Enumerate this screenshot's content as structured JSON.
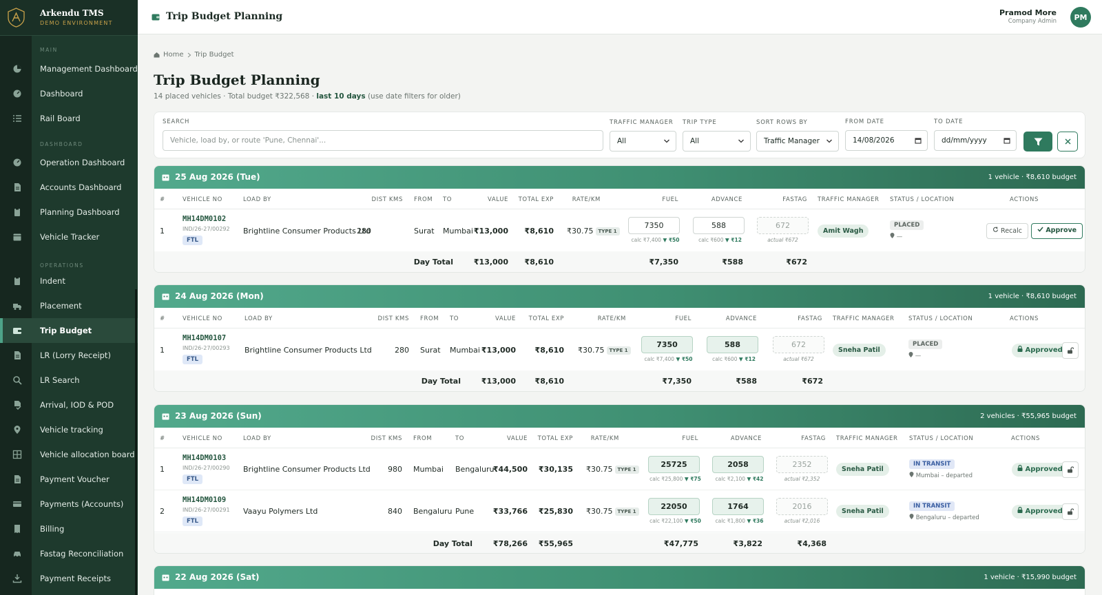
{
  "app": {
    "name": "Arkendu TMS",
    "env": "DEMO ENVIRONMENT"
  },
  "sidebar": {
    "sections": {
      "main": "MAIN",
      "dashboard": "DASHBOARD",
      "operations": "OPERATIONS"
    },
    "items": [
      {
        "label": "Management Dashboard",
        "icon": "pie-chart-icon"
      },
      {
        "label": "Dashboard",
        "icon": "gauge-icon"
      },
      {
        "label": "Rail Board",
        "icon": "list-icon"
      },
      {
        "label": "Operation Dashboard",
        "icon": "gauge-icon"
      },
      {
        "label": "Accounts Dashboard",
        "icon": "file-icon"
      },
      {
        "label": "Planning Dashboard",
        "icon": "clipboard-icon"
      },
      {
        "label": "Vehicle Tracker",
        "icon": "calendar-icon"
      },
      {
        "label": "Indent",
        "icon": "clipboard-icon"
      },
      {
        "label": "Placement",
        "icon": "truck-icon"
      },
      {
        "label": "Trip Budget",
        "icon": "wallet-icon"
      },
      {
        "label": "LR (Lorry Receipt)",
        "icon": "file-icon"
      },
      {
        "label": "LR Search",
        "icon": "search-icon"
      },
      {
        "label": "Arrival, IOD & POD",
        "icon": "file-check-icon"
      },
      {
        "label": "Vehicle tracking",
        "icon": "map-pin-icon"
      },
      {
        "label": "Vehicle allocation board",
        "icon": "grid-icon"
      },
      {
        "label": "Payment Voucher",
        "icon": "file-icon"
      },
      {
        "label": "Payments (Accounts)",
        "icon": "card-icon"
      },
      {
        "label": "Billing",
        "icon": "receipt-icon"
      },
      {
        "label": "Fastag Reconciliation",
        "icon": "car-icon"
      },
      {
        "label": "Payment Receipts",
        "icon": "download-icon"
      }
    ]
  },
  "header": {
    "title": "Trip Budget Planning",
    "user_name": "Pramod More",
    "user_role": "Company Admin",
    "avatar": "PM"
  },
  "breadcrumb": {
    "home": "Home",
    "current": "Trip Budget"
  },
  "page": {
    "title": "Trip Budget Planning",
    "subtitle_a": "14 placed vehicles · Total budget ₹322,568 · ",
    "subtitle_b": "last 10 days",
    "subtitle_c": " (use date filters for older)"
  },
  "filters": {
    "search_label": "SEARCH",
    "search_placeholder": "Vehicle, load by, or route 'Pune, Chennai'...",
    "tm_label": "TRAFFIC MANAGER",
    "tm_value": "All",
    "trip_label": "TRIP TYPE",
    "trip_value": "All",
    "sort_label": "SORT ROWS BY",
    "sort_value": "Traffic Manager",
    "from_label": "FROM DATE",
    "from_value": "14/08/2026",
    "to_label": "TO DATE",
    "to_value": "dd/mm/yyyy"
  },
  "columns": {
    "num": "#",
    "vehicle": "VEHICLE NO",
    "load": "LOAD BY",
    "dist": "DIST KMS",
    "from": "FROM",
    "to": "TO",
    "value": "VALUE",
    "total_exp": "TOTAL EXP",
    "rate": "RATE/KM",
    "fuel": "FUEL",
    "advance": "ADVANCE",
    "fastag": "FASTAG",
    "tm": "TRAFFIC MANAGER",
    "status": "STATUS / LOCATION",
    "actions": "ACTIONS"
  },
  "labels": {
    "day_total": "Day Total",
    "type1": "TYPE 1",
    "ftl": "FTL",
    "recalc": "Recalc",
    "approve": "Approve",
    "approved": "Approved"
  },
  "days": [
    {
      "date": "25 Aug 2026 (Tue)",
      "meta": "1 vehicle · ₹8,610 budget",
      "rows": [
        {
          "n": "1",
          "vehicle": "MH14DM0102",
          "lr": "IND/26-27/00292",
          "load": "Brightline Consumer Products Ltd",
          "dist": "280",
          "from": "Surat",
          "to": "Mumbai",
          "value": "₹13,000",
          "exp": "₹8,610",
          "rate": "₹30.75",
          "fuel": "7350",
          "fuel_calc": "calc ₹7,400",
          "fuel_diff": "▼ ₹50",
          "adv": "588",
          "adv_calc": "calc ₹600",
          "adv_diff": "▼ ₹12",
          "fastag": "672",
          "fastag_actual": "actual ₹672",
          "tm": "Amit Wagh",
          "status": "PLACED",
          "loc": "—"
        }
      ],
      "totals": {
        "value": "₹13,000",
        "exp": "₹8,610",
        "fuel": "₹7,350",
        "adv": "₹588",
        "fastag": "₹672"
      }
    },
    {
      "date": "24 Aug 2026 (Mon)",
      "meta": "1 vehicle · ₹8,610 budget",
      "rows": [
        {
          "n": "1",
          "vehicle": "MH14DM0107",
          "lr": "IND/26-27/00293",
          "load": "Brightline Consumer Products Ltd",
          "dist": "280",
          "from": "Surat",
          "to": "Mumbai",
          "value": "₹13,000",
          "exp": "₹8,610",
          "rate": "₹30.75",
          "fuel": "7350",
          "fuel_calc": "calc ₹7,400",
          "fuel_diff": "▼ ₹50",
          "adv": "588",
          "adv_calc": "calc ₹600",
          "adv_diff": "▼ ₹12",
          "fastag": "672",
          "fastag_actual": "actual ₹672",
          "tm": "Sneha Patil",
          "status": "PLACED",
          "loc": "—"
        }
      ],
      "totals": {
        "value": "₹13,000",
        "exp": "₹8,610",
        "fuel": "₹7,350",
        "adv": "₹588",
        "fastag": "₹672"
      }
    },
    {
      "date": "23 Aug 2026 (Sun)",
      "meta": "2 vehicles · ₹55,965 budget",
      "rows": [
        {
          "n": "1",
          "vehicle": "MH14DM0103",
          "lr": "IND/26-27/00290",
          "load": "Brightline Consumer Products Ltd",
          "dist": "980",
          "from": "Mumbai",
          "to": "Bengaluru",
          "value": "₹44,500",
          "exp": "₹30,135",
          "rate": "₹30.75",
          "fuel": "25725",
          "fuel_calc": "calc ₹25,800",
          "fuel_diff": "▼ ₹75",
          "adv": "2058",
          "adv_calc": "calc ₹2,100",
          "adv_diff": "▼ ₹42",
          "fastag": "2352",
          "fastag_actual": "actual ₹2,352",
          "tm": "Sneha Patil",
          "status": "IN TRANSIT",
          "loc": "Mumbai – departed"
        },
        {
          "n": "2",
          "vehicle": "MH14DM0109",
          "lr": "IND/26-27/00291",
          "load": "Vaayu Polymers Ltd",
          "dist": "840",
          "from": "Bengaluru",
          "to": "Pune",
          "value": "₹33,766",
          "exp": "₹25,830",
          "rate": "₹30.75",
          "fuel": "22050",
          "fuel_calc": "calc ₹22,100",
          "fuel_diff": "▼ ₹50",
          "adv": "1764",
          "adv_calc": "calc ₹1,800",
          "adv_diff": "▼ ₹36",
          "fastag": "2016",
          "fastag_actual": "actual ₹2,016",
          "tm": "Sneha Patil",
          "status": "IN TRANSIT",
          "loc": "Bengaluru – departed"
        }
      ],
      "totals": {
        "value": "₹78,266",
        "exp": "₹55,965",
        "fuel": "₹47,775",
        "adv": "₹3,822",
        "fastag": "₹4,368"
      }
    },
    {
      "date": "22 Aug 2026 (Sat)",
      "meta": "1 vehicle · ₹15,990 budget"
    }
  ],
  "colors": {
    "accent": "#2f7a5e",
    "sidebar": "#1e3a2d",
    "gold": "#c9a24a"
  }
}
